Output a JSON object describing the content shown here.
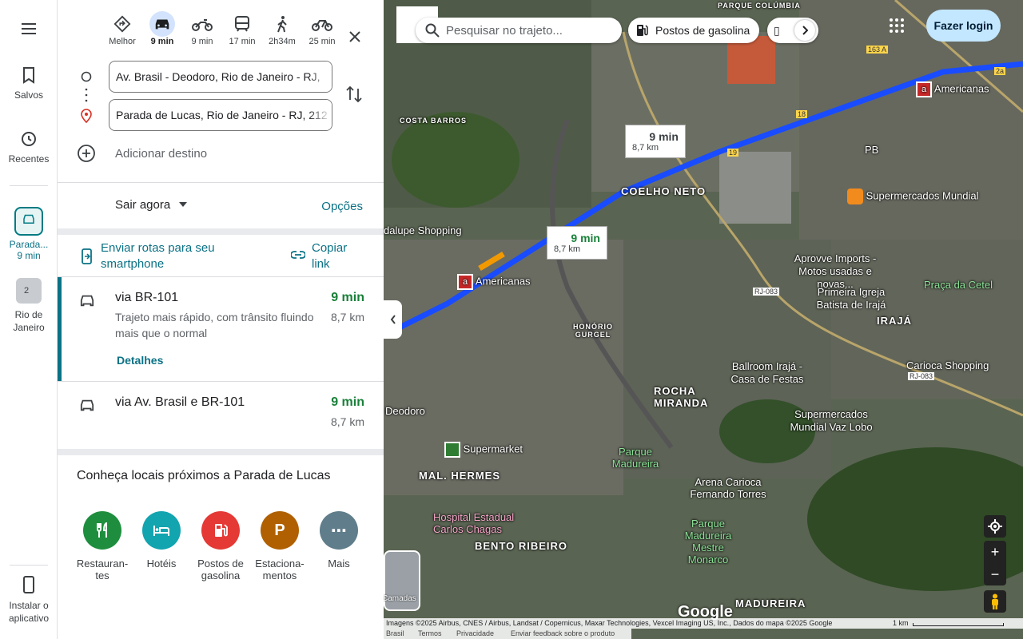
{
  "rail": {
    "saved": "Salvos",
    "recent": "Recentes",
    "trip_label": "Parada...",
    "trip_time": "9 min",
    "recent_place": "Rio de Janeiro",
    "recent_badge": "2",
    "install": "Instalar o aplicativo"
  },
  "modes": [
    {
      "label": "Melhor",
      "icon": "best-route-icon"
    },
    {
      "label": "9 min",
      "icon": "car-icon"
    },
    {
      "label": "9 min",
      "icon": "motorcycle-icon"
    },
    {
      "label": "17 min",
      "icon": "transit-icon"
    },
    {
      "label": "2h34m",
      "icon": "walk-icon"
    },
    {
      "label": "25 min",
      "icon": "bike-icon"
    }
  ],
  "directions": {
    "origin": "Av. Brasil - Deodoro, Rio de Janeiro - RJ,",
    "destination": "Parada de Lucas, Rio de Janeiro - RJ, 212",
    "add_destination": "Adicionar destino",
    "leave_now": "Sair agora",
    "options": "Opções",
    "send_to_phone": "Enviar rotas para seu smartphone",
    "copy_link": "Copiar link"
  },
  "routes": [
    {
      "title": "via BR-101",
      "time": "9 min",
      "distance": "8,7 km",
      "description": "Trajeto mais rápido, com trânsito fluindo mais que o normal",
      "details": "Detalhes"
    },
    {
      "title": "via Av. Brasil e BR-101",
      "time": "9 min",
      "distance": "8,7 km"
    }
  ],
  "nearby": {
    "title": "Conheça locais próximos a Parada de Lucas",
    "items": [
      {
        "label": "Restauran-tes",
        "color": "#1e8e3e",
        "icon": "restaurant-icon"
      },
      {
        "label": "Hotéis",
        "color": "#12a4af",
        "icon": "hotel-icon"
      },
      {
        "label": "Postos de gasolina",
        "color": "#e53935",
        "icon": "gas-station-icon"
      },
      {
        "label": "Estaciona-mentos",
        "color": "#b06000",
        "icon": "parking-icon",
        "glyph": "P"
      },
      {
        "label": "Mais",
        "color": "#607d8b",
        "icon": "more-icon",
        "glyph": "⋯"
      }
    ]
  },
  "map": {
    "search_placeholder": "Pesquisar no trajeto...",
    "gas_chip": "Postos de gasolina",
    "login": "Fazer login",
    "callout1": {
      "time": "9 min",
      "dist": "8,7 km"
    },
    "callout2": {
      "time": "9 min",
      "dist": "8,7 km"
    },
    "layers": "Camadas",
    "attribution": "Imagens ©2025 Airbus, CNES / Airbus, Landsat / Copernicus, Maxar Technologies, Vexcel Imaging US, Inc., Dados do mapa ©2025 Google",
    "scale": "1 km",
    "footer": [
      "Brasil",
      "Termos",
      "Privacidade",
      "Enviar feedback sobre o produto"
    ],
    "google": "Google",
    "route_color": "#1a4cff",
    "labels": {
      "coelho_neto": "COELHO NETO",
      "costa_barros": "COSTA BARROS",
      "pb": "PB",
      "iraja": "IRAJÁ",
      "rocha_miranda": "ROCHA MIRANDA",
      "mal_hermes": "MAL. HERMES",
      "bento_ribeiro": "BENTO RIBEIRO",
      "madureira": "MADUREIRA",
      "honorio": "HONÓRIO GURGEL",
      "americanas1": "Americanas",
      "americanas2": "Americanas",
      "supermercados_mundial": "Supermercados Mundial",
      "guadalupe": "dalupe Shopping",
      "aprovve": "Aprovve Imports - Motos usadas e novas...",
      "igreja": "Primeira Igreja Batista de Irajá",
      "praca": "Praça da Cetel",
      "ballroom": "Ballroom Irajá - Casa de Festas",
      "carioca": "Carioca Shopping",
      "vaz_lobo": "Supermercados Mundial Vaz Lobo",
      "deodoro": "Deodoro",
      "supermarket": "Supermarket",
      "parque_madureira": "Parque Madureira",
      "arena": "Arena Carioca Fernando Torres",
      "hospital": "Hospital Estadual Carlos Chagas",
      "parque_mestre": "Parque Madureira Mestre Monarco",
      "parque_colombia": "PARQUE COLÚMBIA",
      "rj083a": "RJ-083",
      "rj083b": "RJ-083",
      "r163": "163 A",
      "r18": "18",
      "r19": "19",
      "r2a": "2a"
    }
  }
}
